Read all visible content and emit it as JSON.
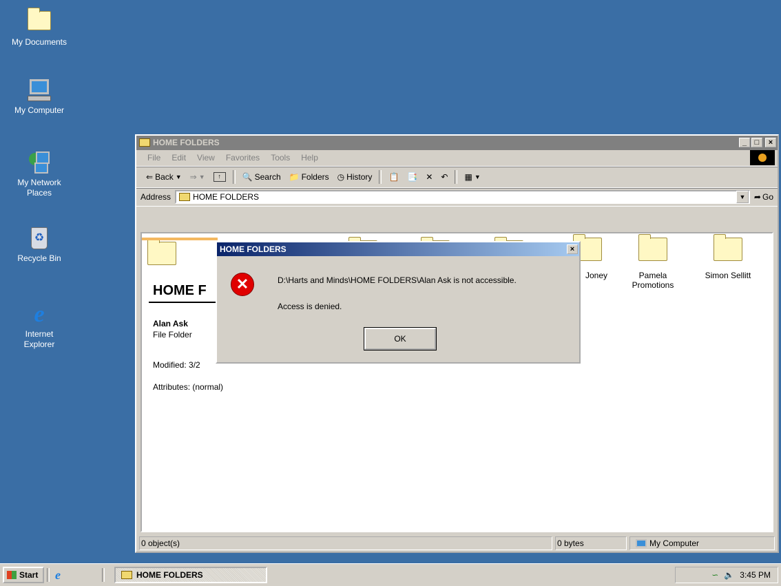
{
  "desktop": {
    "icons": [
      {
        "label": "My Documents"
      },
      {
        "label": "My Computer"
      },
      {
        "label_line1": "My Network",
        "label_line2": "Places"
      },
      {
        "label": "Recycle Bin"
      },
      {
        "label_line1": "Internet",
        "label_line2": "Explorer"
      }
    ]
  },
  "window": {
    "title": "HOME FOLDERS",
    "menu": [
      "File",
      "Edit",
      "View",
      "Favorites",
      "Tools",
      "Help"
    ],
    "toolbar": {
      "back": "Back",
      "search": "Search",
      "folders": "Folders",
      "history": "History"
    },
    "address": {
      "label": "Address",
      "value": "HOME FOLDERS",
      "go": "Go"
    },
    "content": {
      "heading": "HOME F",
      "selected_name": "Alan Ask",
      "selected_type": "File Folder",
      "modified": "Modified: 3/2",
      "attributes": "Attributes: (normal)",
      "folders": [
        {
          "name_line1": "Joney",
          "name_line2": ""
        },
        {
          "name_line1": "Pamela",
          "name_line2": "Promotions"
        },
        {
          "name_line1": "Simon Sellitt",
          "name_line2": ""
        }
      ]
    },
    "status": {
      "objects": "0 object(s)",
      "size": "0 bytes",
      "zone": "My Computer"
    }
  },
  "dialog": {
    "title": "HOME FOLDERS",
    "message": "D:\\Harts and Minds\\HOME FOLDERS\\Alan Ask is not accessible.",
    "detail": "Access is denied.",
    "ok": "OK",
    "close": "×"
  },
  "taskbar": {
    "start": "Start",
    "task": "HOME FOLDERS",
    "clock": "3:45 PM"
  },
  "colors": {
    "desktop": "#3a6ea5",
    "dialog_title": "#0a246a",
    "error": "#e00000"
  }
}
